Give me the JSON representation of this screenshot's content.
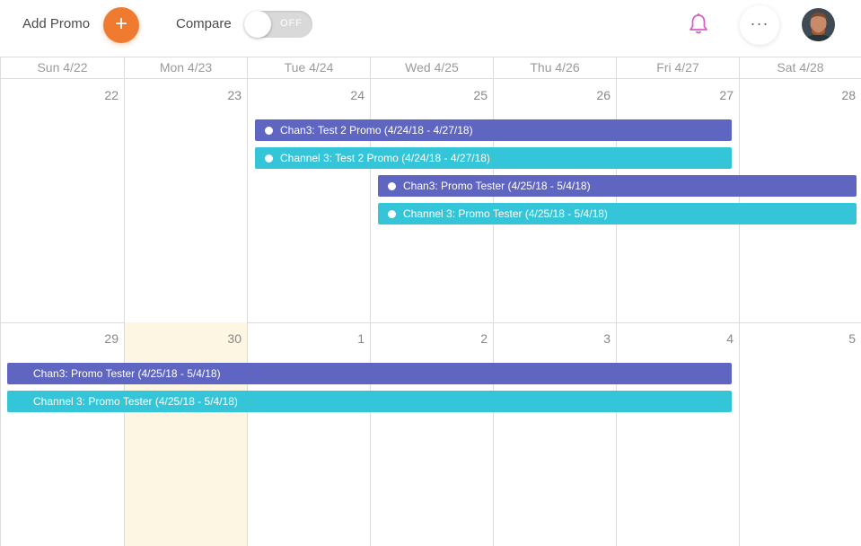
{
  "topbar": {
    "add_label": "Add Promo",
    "add_icon": "+",
    "compare_label": "Compare",
    "toggle_state": "OFF",
    "more_icon": "···"
  },
  "colors": {
    "accent_orange": "#ef7b30",
    "event_purple": "#5f66c2",
    "event_cyan": "#34c6d8",
    "today_bg": "#fdf6e3",
    "bell_pink": "#d65fc9"
  },
  "calendar": {
    "headers": [
      "Sun 4/22",
      "Mon 4/23",
      "Tue 4/24",
      "Wed 4/25",
      "Thu 4/26",
      "Fri 4/27",
      "Sat 4/28"
    ],
    "week1": [
      "22",
      "23",
      "24",
      "25",
      "26",
      "27",
      "28"
    ],
    "week2": [
      "29",
      "30",
      "1",
      "2",
      "3",
      "4",
      "5"
    ],
    "today_label": "30",
    "events": {
      "e1": "Chan3: Test 2 Promo (4/24/18 - 4/27/18)",
      "e2": "Channel 3: Test 2 Promo (4/24/18 - 4/27/18)",
      "e3": "Chan3: Promo Tester (4/25/18 - 5/4/18)",
      "e4": "Channel 3: Promo Tester (4/25/18 - 5/4/18)",
      "e5": "Chan3: Promo Tester (4/25/18 - 5/4/18)",
      "e6": "Channel 3: Promo Tester (4/25/18 - 5/4/18)"
    }
  }
}
